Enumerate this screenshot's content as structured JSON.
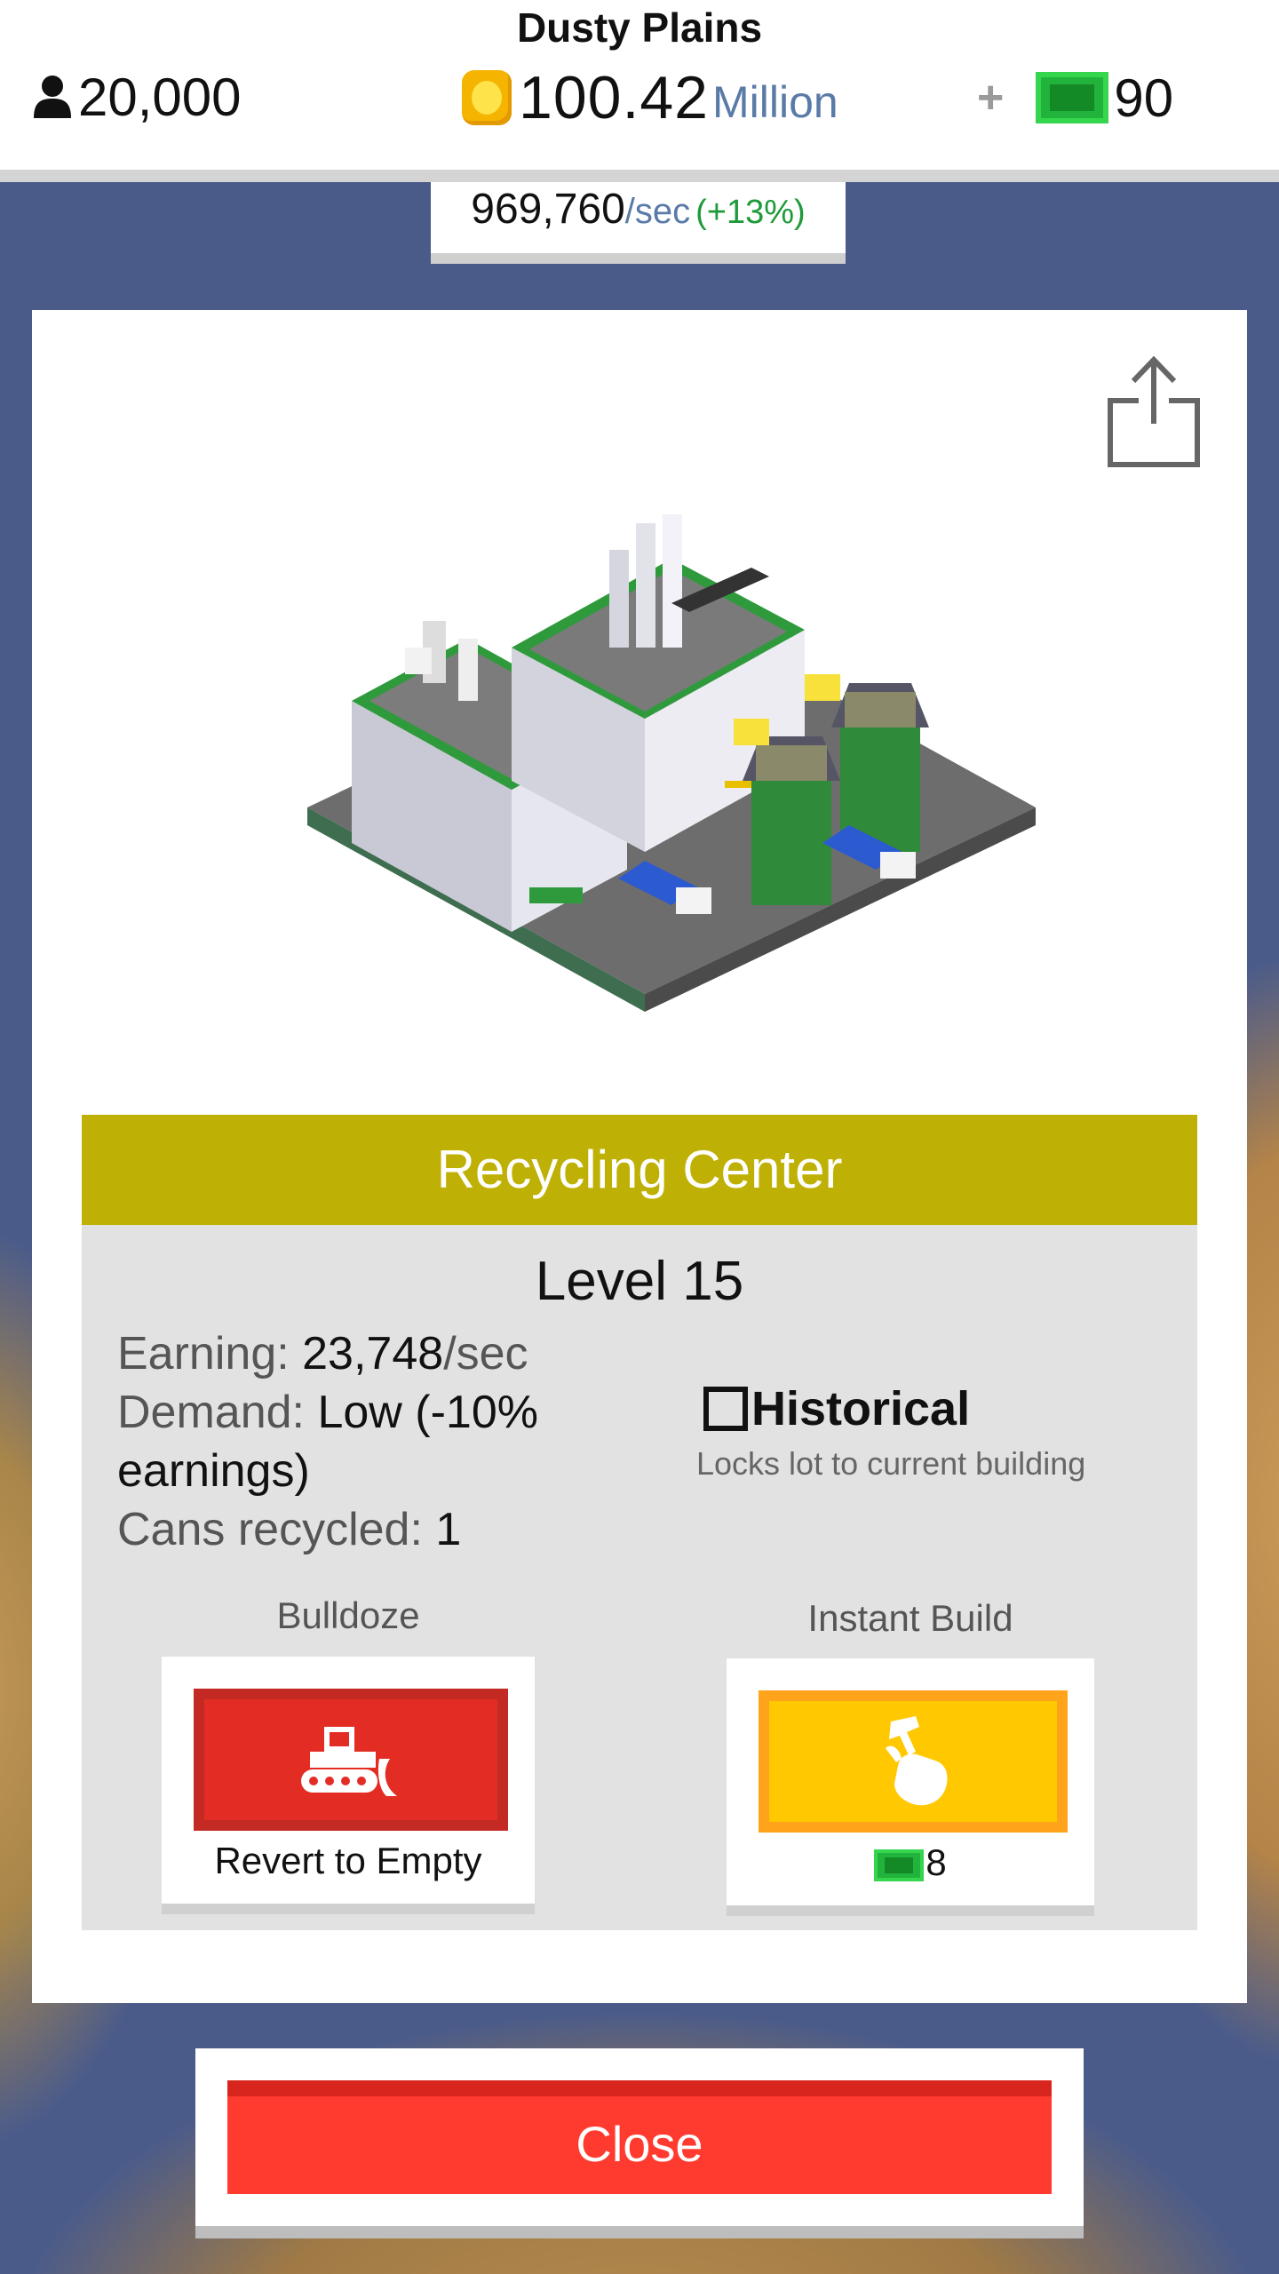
{
  "hud": {
    "title": "Dusty Plains",
    "population": "20,000",
    "coins_value": "100.42",
    "coins_unit": "Million",
    "plus": "+",
    "cash_value": "90"
  },
  "rate": {
    "value": "969,760",
    "unit": "/sec",
    "bonus": "(+13%)"
  },
  "building": {
    "name": "Recycling Center",
    "level": "Level 15",
    "earning_label": "Earning:",
    "earning_value": "23,748",
    "earning_unit": "/sec",
    "demand_label": "Demand:",
    "demand_value": "Low (-10%",
    "demand_value_2": "earnings)",
    "cans_label": "Cans recycled:",
    "cans_value": "1"
  },
  "historical": {
    "label": "Historical",
    "checked": false,
    "description": "Locks lot to current building"
  },
  "actions": {
    "bulldoze_label": "Bulldoze",
    "bulldoze_caption": "Revert to Empty",
    "instant_label": "Instant Build",
    "instant_cost": "8"
  },
  "close_label": "Close",
  "colors": {
    "header_bg": "#bfb005",
    "bulldoze": "#e32d24",
    "instant": "#ffc800",
    "close": "#ff3b30",
    "cash_green": "#22b33c",
    "coin_gold": "#f5b400"
  },
  "icons": [
    "person-icon",
    "coin-icon",
    "cash-icon",
    "share-icon",
    "bulldozer-icon",
    "hammer-hand-icon"
  ]
}
